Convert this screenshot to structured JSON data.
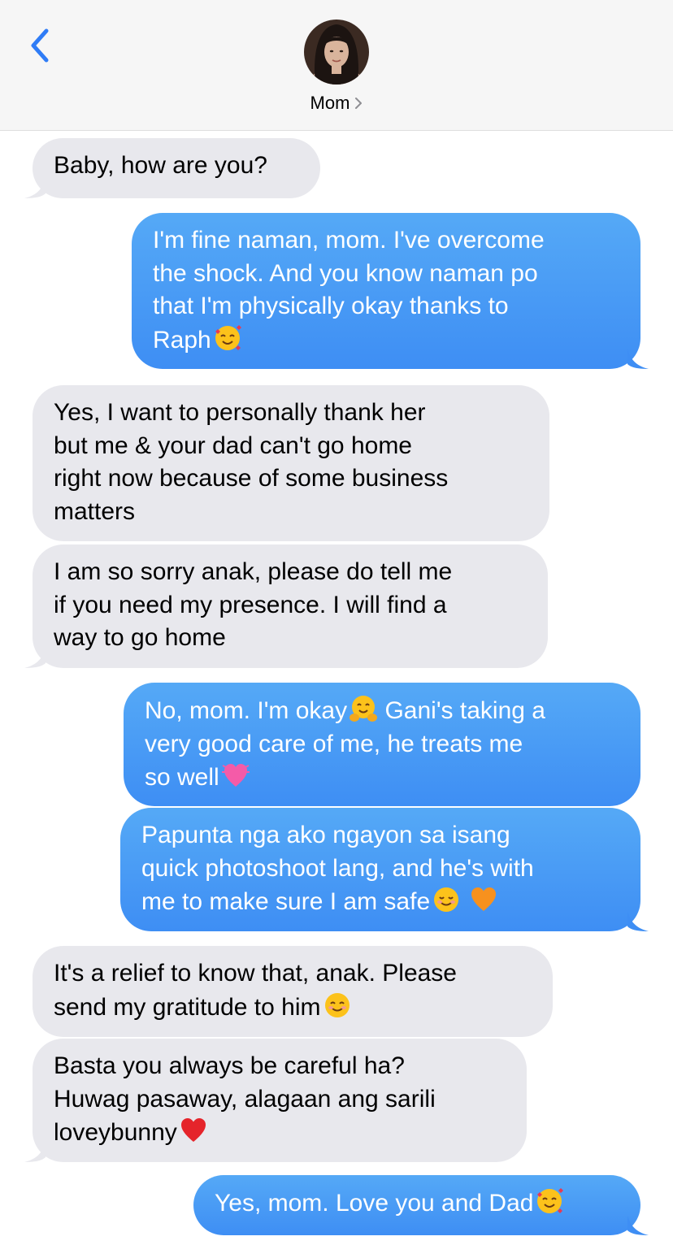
{
  "header": {
    "contact_name": "Mom",
    "avatar_icon": "contact-avatar-photo"
  },
  "colors": {
    "incoming_bubble": "#e8e8ed",
    "outgoing_bubble": "#3e8ef4",
    "accent": "#2f7cf6"
  },
  "messages": [
    {
      "direction": "in",
      "text": "Baby, how are you?",
      "emoji": ""
    },
    {
      "direction": "out",
      "text": "I'm fine naman, mom. I've overcome\nthe shock. And you know naman po\nthat I'm physically okay thanks to\nRaph",
      "emoji": "smiling-face-with-hearts-icon"
    },
    {
      "direction": "in",
      "text": "Yes, I want to personally thank her\nbut me & your dad can't go home\nright now because of some business\nmatters",
      "emoji": ""
    },
    {
      "direction": "in",
      "text": "I am so sorry anak, please do tell me\nif you need my presence. I will find a\nway to go home",
      "emoji": ""
    },
    {
      "direction": "out",
      "text": "No, mom. I'm okay",
      "text2": " Gani's taking a\nvery good care of me, he treats me\nso well",
      "emoji": "hugging-face-icon",
      "emoji2": "growing-heart-icon"
    },
    {
      "direction": "out",
      "text": "Papunta nga ako ngayon sa isang\nquick photoshoot lang, and he's with\nme to make sure I am safe",
      "emoji": "smiling-face-icon",
      "emoji2": "orange-heart-icon"
    },
    {
      "direction": "in",
      "text": "It's a relief to know that, anak. Please\nsend my gratitude to him",
      "emoji": "smiling-face-with-smiling-eyes-icon"
    },
    {
      "direction": "in",
      "text": "Basta you always be careful ha?\nHuwag pasaway, alagaan ang sarili\nloveybunny",
      "emoji": "red-heart-icon"
    },
    {
      "direction": "out",
      "text": "Yes, mom. Love you and Dad",
      "emoji": "smiling-face-with-hearts-icon"
    }
  ]
}
